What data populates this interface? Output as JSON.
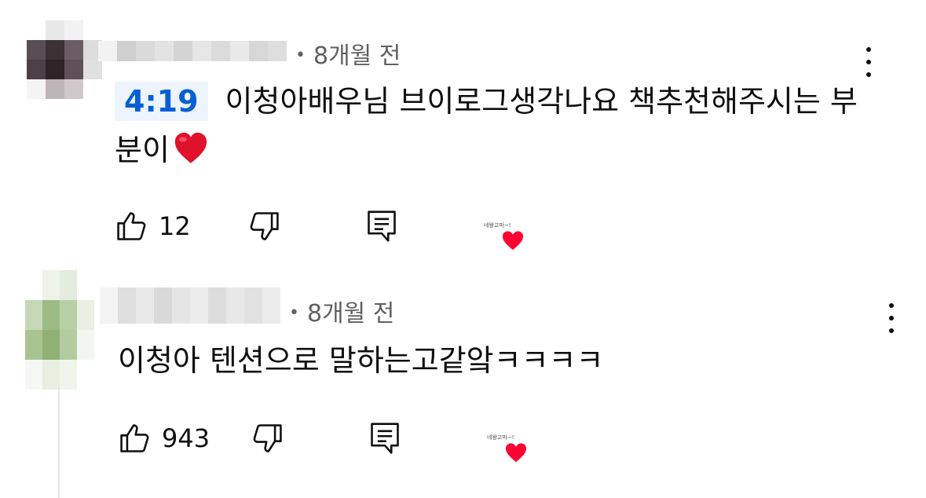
{
  "comments": [
    {
      "time_ago": "8개월 전",
      "timestamp_link": "4:19",
      "text": "이청아배우님 브이로그생각나요 책추천해주시는 부분이",
      "likes": "12",
      "creator_heart_caption": "네왕고마~!",
      "avatar_colors": [
        "#ffffff",
        "#e8e8e8",
        "#f2f2f2",
        "#ffffff",
        "#5a4e54",
        "#3e3136",
        "#6b5d63",
        "#dcdcdc",
        "#4d4046",
        "#2f2328",
        "#5f5157",
        "#e0e0e0",
        "#f4f4f4",
        "#bdb6b9",
        "#cfc9cc",
        "#ffffff"
      ],
      "name_blur_colors": [
        "#f2f2f2",
        "#cfcfcf",
        "#dadada",
        "#e3e3e3",
        "#d4d4d4",
        "#e6e6e6",
        "#dbdbdb",
        "#e9e9e9",
        "#d7d7d7",
        "#dedede"
      ]
    },
    {
      "time_ago": "8개월 전",
      "text": "이청아 텐션으로 말하는고같앜ㅋㅋㅋㅋ",
      "likes": "943",
      "creator_heart_caption": "네왕고마~!",
      "avatar_colors": [
        "#ffffff",
        "#eef3ea",
        "#e3ecdd",
        "#ffffff",
        "#c7d8b9",
        "#9dbb84",
        "#b8cfa5",
        "#e9f0e3",
        "#a8c491",
        "#8fb274",
        "#b3cb9e",
        "#f3f6f0",
        "#f5f8f2",
        "#e7efe0",
        "#f0f5ec",
        "#ffffff"
      ],
      "name_blur_colors": [
        "#f3f3f3",
        "#dedede",
        "#e9e9e9",
        "#d9d9d9",
        "#e5e5e5",
        "#ececec",
        "#dcdcdc",
        "#e8e8e8",
        "#e1e1e1",
        "#ebebeb"
      ]
    }
  ],
  "colors": {
    "timestamp_text": "#065fd4",
    "timestamp_bg": "#eef4fd",
    "meta_text": "#606060",
    "heart_red": "#ff0033"
  },
  "icons": [
    "like-icon",
    "dislike-icon",
    "reply-icon",
    "more-vert-icon",
    "creator-heart-icon",
    "red-heart-emoji"
  ]
}
